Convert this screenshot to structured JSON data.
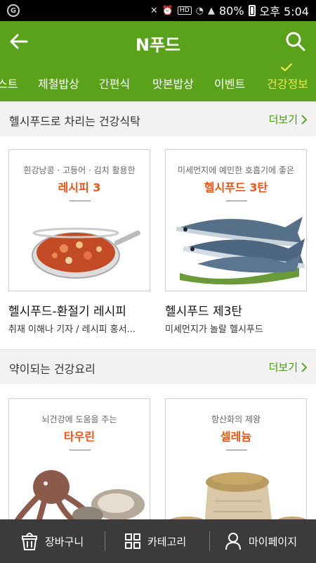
{
  "status_bar": {
    "app_indicator": "G",
    "network_label": "HD",
    "battery": "80%",
    "time": "오후 5:04"
  },
  "header": {
    "title": "N푸드"
  },
  "tabs": [
    {
      "label": "스트",
      "active": false
    },
    {
      "label": "제철밥상",
      "active": false
    },
    {
      "label": "간편식",
      "active": false
    },
    {
      "label": "맛본밥상",
      "active": false
    },
    {
      "label": "이벤트",
      "active": false
    },
    {
      "label": "건강정보",
      "active": true
    }
  ],
  "sections": [
    {
      "title": "헬시푸드로 차리는 건강식탁",
      "more_label": "더보기",
      "cards": [
        {
          "subtitle": "흰강낭콩 · 고등어 · 김치 활용한",
          "highlight": "레시피 3",
          "title": "헬시푸드-환절기 레시피",
          "desc": "취재 이해나 기자 / 레시피 홍서..."
        },
        {
          "subtitle": "미세먼지에 예민한 호흡기에 좋은",
          "highlight": "헬시푸드 3탄",
          "title": "헬시푸드 제3탄",
          "desc": "미세먼지가 놀랄 헬시푸드"
        }
      ]
    },
    {
      "title": "약이되는 건강요리",
      "more_label": "더보기",
      "cards": [
        {
          "subtitle": "뇌건강에 도움을 주는",
          "highlight": "타우린",
          "title": "",
          "desc": ""
        },
        {
          "subtitle": "항산화의 제왕",
          "highlight": "셀레늄",
          "title": "",
          "desc": ""
        }
      ]
    }
  ],
  "bottom_nav": [
    {
      "label": "장바구니",
      "icon": "basket-icon"
    },
    {
      "label": "카테고리",
      "icon": "grid-icon"
    },
    {
      "label": "마이페이지",
      "icon": "person-icon"
    }
  ],
  "colors": {
    "brand_green": "#5aa21b",
    "active_tab": "#f3e84a",
    "accent_orange": "#e8561a",
    "bottom_nav": "#3b3b3b"
  }
}
